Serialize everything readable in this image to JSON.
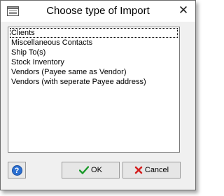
{
  "window": {
    "title": "Choose type of Import",
    "close_glyph": "✕"
  },
  "list": {
    "items": [
      "Clients",
      "Miscellaneous Contacts",
      "Ship To(s)",
      "Stock Inventory",
      "Vendors (Payee same as Vendor)",
      "Vendors (with seperate Payee address)"
    ],
    "selected_index": 0
  },
  "buttons": {
    "help_glyph": "?",
    "ok_label": "OK",
    "cancel_label": "Cancel"
  },
  "icons": {
    "window_icon": "window-form-icon",
    "ok_icon": "checkmark-icon",
    "cancel_icon": "x-cross-icon",
    "help_icon": "help-question-icon"
  },
  "colors": {
    "ok_check": "#1a9a2a",
    "cancel_x": "#d42020",
    "help_blue": "#2a6fd1"
  }
}
